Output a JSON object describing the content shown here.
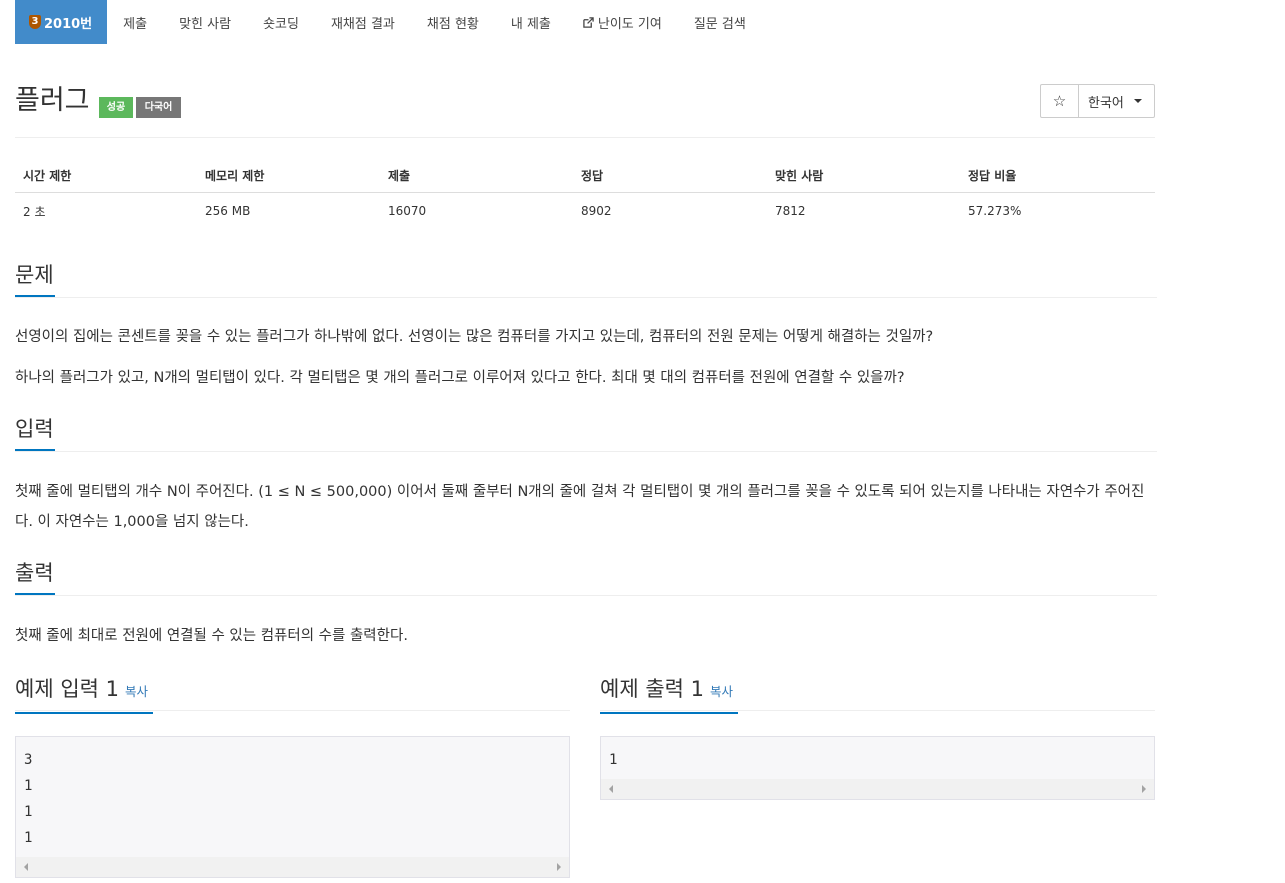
{
  "nav": {
    "tier_badge": "3",
    "problem_number": "2010번",
    "items": [
      "제출",
      "맞힌 사람",
      "숏코딩",
      "재채점 결과",
      "채점 현황",
      "내 제출",
      "난이도 기여",
      "질문 검색"
    ]
  },
  "problem": {
    "title": "플러그",
    "label_success": "성공",
    "label_multilang": "다국어",
    "star_icon": "☆",
    "language": "한국어"
  },
  "info_table": {
    "headers": [
      "시간 제한",
      "메모리 제한",
      "제출",
      "정답",
      "맞힌 사람",
      "정답 비율"
    ],
    "values": [
      "2 초",
      "256 MB",
      "16070",
      "8902",
      "7812",
      "57.273%"
    ]
  },
  "sections": {
    "problem_heading": "문제",
    "problem_text_1": "선영이의 집에는 콘센트를 꽂을 수 있는 플러그가 하나밖에 없다. 선영이는 많은 컴퓨터를 가지고 있는데, 컴퓨터의 전원 문제는 어떻게 해결하는 것일까?",
    "problem_text_2": "하나의 플러그가 있고, N개의 멀티탭이 있다. 각 멀티탭은 몇 개의 플러그로 이루어져 있다고 한다. 최대 몇 대의 컴퓨터를 전원에 연결할 수 있을까?",
    "input_heading": "입력",
    "input_text": "첫째 줄에 멀티탭의 개수 N이 주어진다. (1 ≤ N ≤ 500,000) 이어서 둘째 줄부터 N개의 줄에 걸쳐 각 멀티탭이 몇 개의 플러그를 꽂을 수 있도록 되어 있는지를 나타내는 자연수가 주어진다. 이 자연수는 1,000을 넘지 않는다.",
    "output_heading": "출력",
    "output_text": "첫째 줄에 최대로 전원에 연결될 수 있는 컴퓨터의 수를 출력한다."
  },
  "samples": {
    "input_heading": "예제 입력 1",
    "output_heading": "예제 출력 1",
    "copy_label": "복사",
    "input_data": "3\n1\n1\n1",
    "output_data": "1"
  },
  "colors": {
    "primary": "#428bca",
    "success": "#5cb85c",
    "muted": "#777777",
    "tier": "#ad5600",
    "heading_underline": "#0076c0"
  }
}
